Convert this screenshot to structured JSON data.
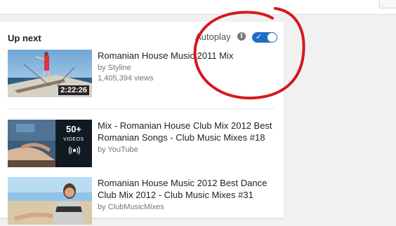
{
  "sidebar": {
    "header": "Up next",
    "autoplay_label": "Autoplay",
    "info_symbol": "i",
    "autoplay_on": true
  },
  "videos": [
    {
      "title": "Romanian House Music 2011 Mix",
      "channel": "by Styline",
      "views": "1,405,394 views",
      "duration": "2:22:26"
    },
    {
      "title": "Mix - Romanian House Club Mix 2012 Best Romanian Songs - Club Music Mixes #18",
      "channel": "by YouTube",
      "playlist_count": "50+",
      "playlist_label": "VIDEOS"
    },
    {
      "title": "Romanian House Music 2012 Best Dance Club Mix 2012 - Club Music Mixes #31",
      "channel": "by ClubMusicMixes"
    }
  ],
  "colors": {
    "toggle": "#1e6ec8",
    "annotation": "#d7191c"
  }
}
